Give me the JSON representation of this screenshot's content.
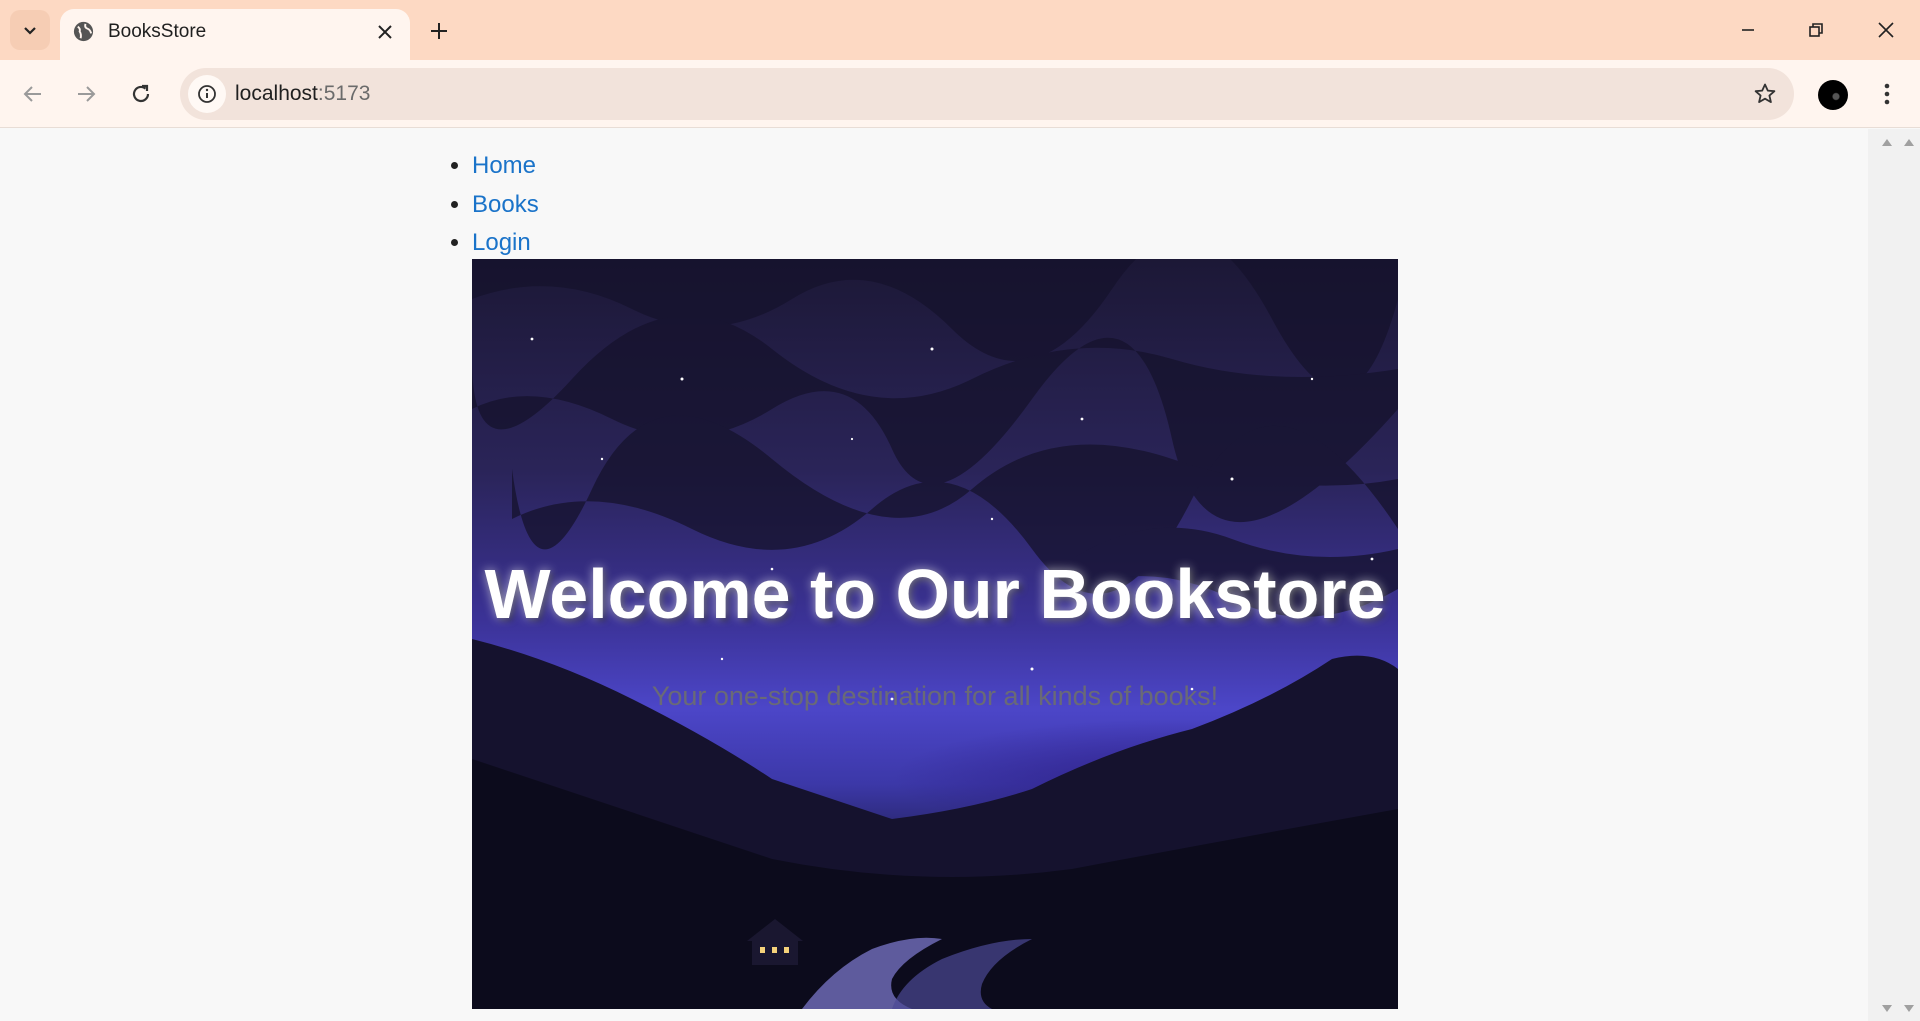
{
  "browser": {
    "tab_title": "BooksStore",
    "url_host": "localhost",
    "url_port": ":5173"
  },
  "page": {
    "nav": [
      {
        "label": "Home"
      },
      {
        "label": "Books"
      },
      {
        "label": "Login"
      }
    ],
    "hero": {
      "title": "Welcome to Our Bookstore",
      "subtitle": "Your one-stop destination for all kinds of books!"
    }
  },
  "colors": {
    "tabstrip": "#fdd9c3",
    "toolbar": "#fff5ef",
    "link": "#1a73c9",
    "page_bg": "#f8f8f8"
  }
}
